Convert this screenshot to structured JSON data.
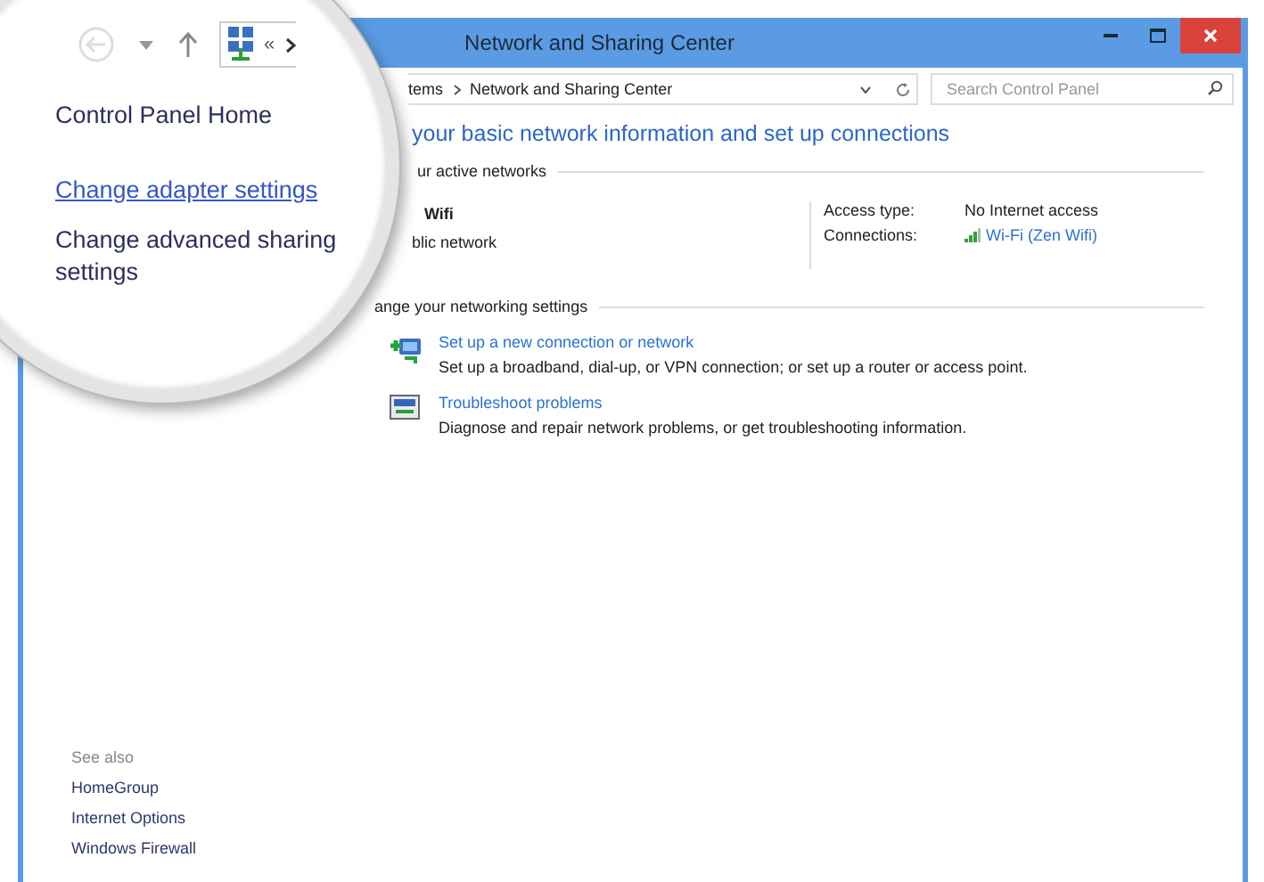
{
  "window": {
    "title": "Network and Sharing Center"
  },
  "address_bar": {
    "breadcrumb": [
      "tems",
      "Network and Sharing Center"
    ]
  },
  "search": {
    "placeholder": "Search Control Panel"
  },
  "magnifier": {
    "address_glyph": "«",
    "nav_links": [
      {
        "text": "Control Panel Home",
        "kind": "plain"
      },
      {
        "text": "Change adapter settings",
        "kind": "link"
      },
      {
        "text": "Change advanced sharing settings",
        "kind": "plain"
      }
    ]
  },
  "see_also": {
    "title": "See also",
    "links": [
      "HomeGroup",
      "Internet Options",
      "Windows Firewall"
    ]
  },
  "heading": "your basic network information and set up connections",
  "active_networks": {
    "title": "ur active networks",
    "network_name": "Wifi",
    "network_type": "blic network",
    "access_type_label": "Access type:",
    "access_type": "No Internet access",
    "connections_label": "Connections:",
    "connection": "Wi-Fi (Zen Wifi)"
  },
  "networking_settings": {
    "title": "ange your networking settings",
    "items": [
      {
        "kind": "setup",
        "link": "Set up a new connection or network",
        "description": "Set up a broadband, dial-up, or VPN connection; or set up a router or access point."
      },
      {
        "kind": "troubleshoot",
        "link": "Troubleshoot problems",
        "description": "Diagnose and repair network problems, or get troubleshooting information."
      }
    ]
  }
}
